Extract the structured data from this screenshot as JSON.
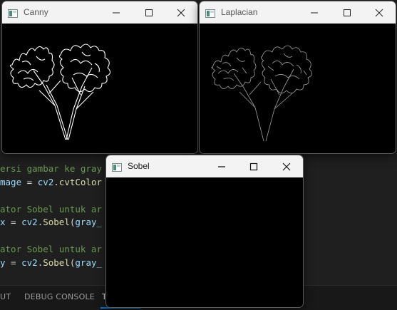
{
  "editor": {
    "lines": [
      {
        "parts": [
          {
            "cls": "c-comment",
            "text": "ersi gambar ke gray"
          }
        ]
      },
      {
        "parts": [
          {
            "cls": "c-var",
            "text": "mage"
          },
          {
            "cls": "c-op",
            "text": " = "
          },
          {
            "cls": "c-var",
            "text": "cv2"
          },
          {
            "cls": "c-op",
            "text": "."
          },
          {
            "cls": "c-fn",
            "text": "cvtColor"
          }
        ]
      },
      {
        "parts": []
      },
      {
        "parts": [
          {
            "cls": "c-comment",
            "text": "ator Sobel untuk ar"
          }
        ]
      },
      {
        "parts": [
          {
            "cls": "c-var",
            "text": "x"
          },
          {
            "cls": "c-op",
            "text": " = "
          },
          {
            "cls": "c-var",
            "text": "cv2"
          },
          {
            "cls": "c-op",
            "text": "."
          },
          {
            "cls": "c-fn",
            "text": "Sobel"
          },
          {
            "cls": "c-op",
            "text": "("
          },
          {
            "cls": "c-var",
            "text": "gray_"
          }
        ]
      },
      {
        "parts": []
      },
      {
        "parts": [
          {
            "cls": "c-comment",
            "text": "ator Sobel untuk ar"
          }
        ]
      },
      {
        "parts": [
          {
            "cls": "c-var",
            "text": "y"
          },
          {
            "cls": "c-op",
            "text": " = "
          },
          {
            "cls": "c-var",
            "text": "cv2"
          },
          {
            "cls": "c-op",
            "text": "."
          },
          {
            "cls": "c-fn",
            "text": "Sobel"
          },
          {
            "cls": "c-op",
            "text": "("
          },
          {
            "cls": "c-var",
            "text": "gray_"
          }
        ]
      }
    ]
  },
  "panel": {
    "tabs": [
      {
        "label": "UT",
        "active": false
      },
      {
        "label": "DEBUG CONSOLE",
        "active": false
      },
      {
        "label": "T",
        "active": true
      }
    ]
  },
  "windows": {
    "canny": {
      "title": "Canny"
    },
    "laplacian": {
      "title": "Laplacian"
    },
    "sobel": {
      "title": "Sobel"
    }
  },
  "colors": {
    "comment": "#6a9955",
    "variable": "#9cdcfe",
    "function": "#dcdcaa",
    "accent": "#0078d4"
  }
}
